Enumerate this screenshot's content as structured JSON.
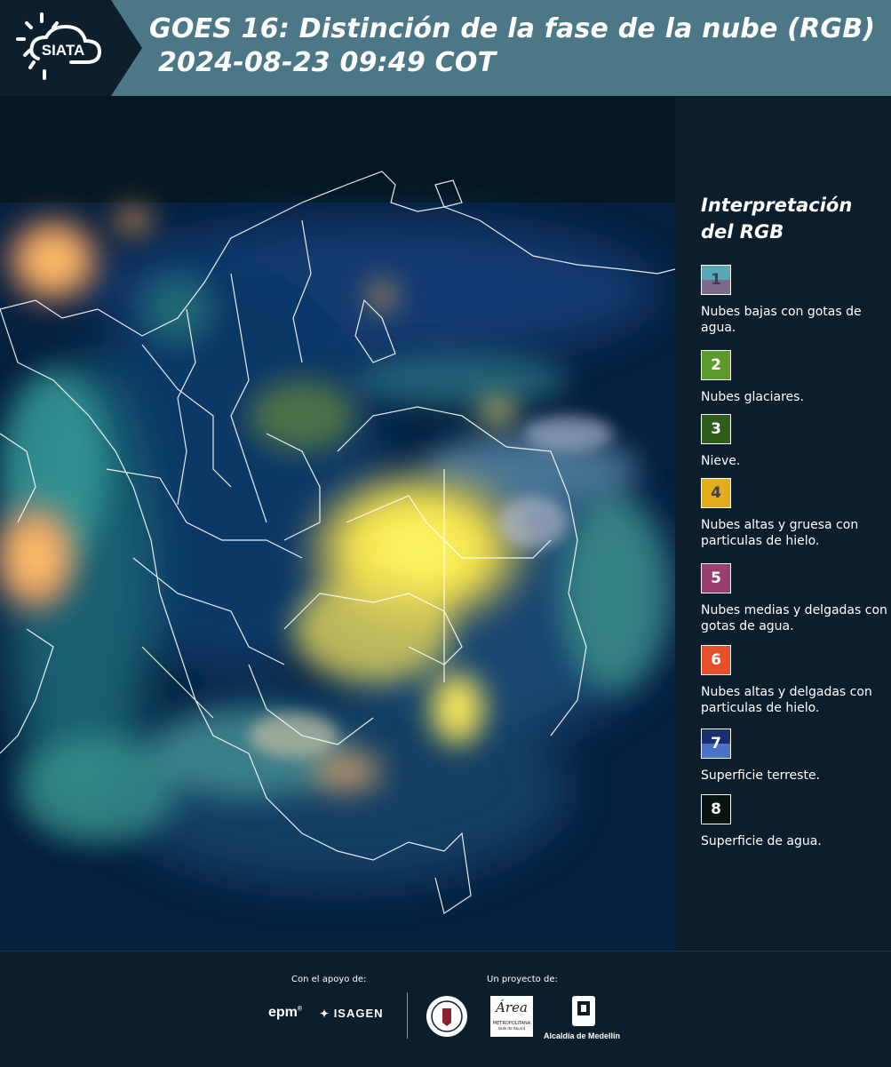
{
  "header": {
    "title_line1": "GOES 16: Distinción de la fase de la nube (RGB)",
    "title_line2": "2024-08-23 09:49 COT",
    "logo_text": "SIATA"
  },
  "legend": {
    "title_line1": "Interpretación",
    "title_line2": "del RGB",
    "items": [
      {
        "number": "1",
        "label": "Nubes bajas con gotas de agua.",
        "color": "#5aa5b6",
        "color_bottom": "#7a6c8a"
      },
      {
        "number": "2",
        "label": "Nubes glaciares.",
        "color": "#5d9a2c"
      },
      {
        "number": "3",
        "label": "Nieve.",
        "color": "#2e5d1d"
      },
      {
        "number": "4",
        "label": "Nubes altas y gruesa con particulas de hielo.",
        "color": "#e1ad1d"
      },
      {
        "number": "5",
        "label": "Nubes medias y delgadas con gotas de agua.",
        "color": "#9b3f73"
      },
      {
        "number": "6",
        "label": "Nubes altas y delgadas con particulas de hielo.",
        "color": "#e5502a"
      },
      {
        "number": "7",
        "label": "Superficie terreste.",
        "color": "#1b2e6e",
        "color_bottom": "#4a72c6"
      },
      {
        "number": "8",
        "label": "Superficie de agua.",
        "color": "#0a1410"
      }
    ]
  },
  "footer": {
    "support_label": "Con el apoyo de:",
    "project_label": "Un proyecto de:",
    "sponsor_epm": "epm",
    "sponsor_isagen": "ISAGEN",
    "area_name": "Área",
    "area_sub": "METROPOLITANA",
    "area_sub2": "Valle de Aburrá",
    "alcaldia": "Alcaldía de Medellín"
  }
}
